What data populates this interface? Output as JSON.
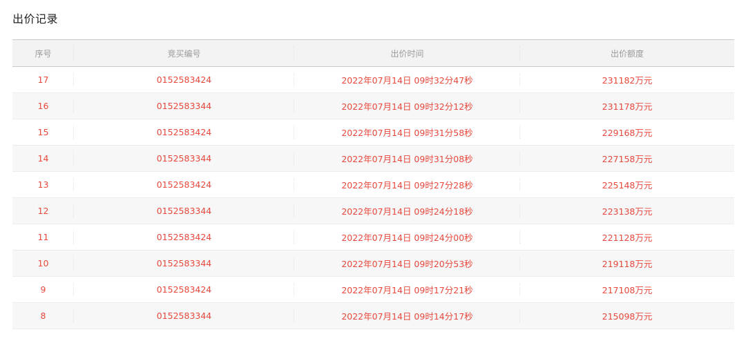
{
  "page": {
    "title": "出价记录"
  },
  "table": {
    "headers": [
      "序号",
      "竞买编号",
      "出价时间",
      "出价额度"
    ],
    "rows": [
      {
        "seq": "17",
        "bidder_no": "0152583424",
        "time": "2022年07月14日 09时32分47秒",
        "amount": "231182万元"
      },
      {
        "seq": "16",
        "bidder_no": "0152583344",
        "time": "2022年07月14日 09时32分12秒",
        "amount": "231178万元"
      },
      {
        "seq": "15",
        "bidder_no": "0152583424",
        "time": "2022年07月14日 09时31分58秒",
        "amount": "229168万元"
      },
      {
        "seq": "14",
        "bidder_no": "0152583344",
        "time": "2022年07月14日 09时31分08秒",
        "amount": "227158万元"
      },
      {
        "seq": "13",
        "bidder_no": "0152583424",
        "time": "2022年07月14日 09时27分28秒",
        "amount": "225148万元"
      },
      {
        "seq": "12",
        "bidder_no": "0152583344",
        "time": "2022年07月14日 09时24分18秒",
        "amount": "223138万元"
      },
      {
        "seq": "11",
        "bidder_no": "0152583424",
        "time": "2022年07月14日 09时24分00秒",
        "amount": "221128万元"
      },
      {
        "seq": "10",
        "bidder_no": "0152583344",
        "time": "2022年07月14日 09时20分53秒",
        "amount": "219118万元"
      },
      {
        "seq": "9",
        "bidder_no": "0152583424",
        "time": "2022年07月14日 09时17分21秒",
        "amount": "217108万元"
      },
      {
        "seq": "8",
        "bidder_no": "0152583344",
        "time": "2022年07月14日 09时14分17秒",
        "amount": "215098万元"
      }
    ]
  },
  "colors": {
    "accent_text": "#e8483c",
    "header_bg": "#f3f3f3",
    "stripe_bg": "#f7f7f7"
  }
}
